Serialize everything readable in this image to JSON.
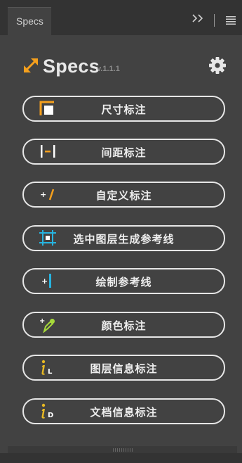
{
  "tab": {
    "label": "Specs"
  },
  "header": {
    "logo_text": "Specs",
    "version": "v.1.1.1"
  },
  "buttons": [
    {
      "label": "尺寸标注",
      "icon": "size-annotation-icon"
    },
    {
      "label": "间距标注",
      "icon": "spacing-annotation-icon"
    },
    {
      "label": "自定义标注",
      "icon": "custom-annotation-icon"
    },
    {
      "label": "选中图层生成参考线",
      "icon": "layer-guides-icon"
    },
    {
      "label": "绘制参考线",
      "icon": "draw-guide-icon"
    },
    {
      "label": "颜色标注",
      "icon": "color-picker-icon"
    },
    {
      "label": "图层信息标注",
      "icon": "layer-info-icon"
    },
    {
      "label": "文档信息标注",
      "icon": "document-info-icon"
    }
  ],
  "icon_letters": {
    "layer": "L",
    "document": "D"
  },
  "colors": {
    "accent_orange": "#f5a01d",
    "accent_cyan": "#27b4e0",
    "accent_yellow": "#e8b923",
    "accent_green": "#a6d93a"
  }
}
